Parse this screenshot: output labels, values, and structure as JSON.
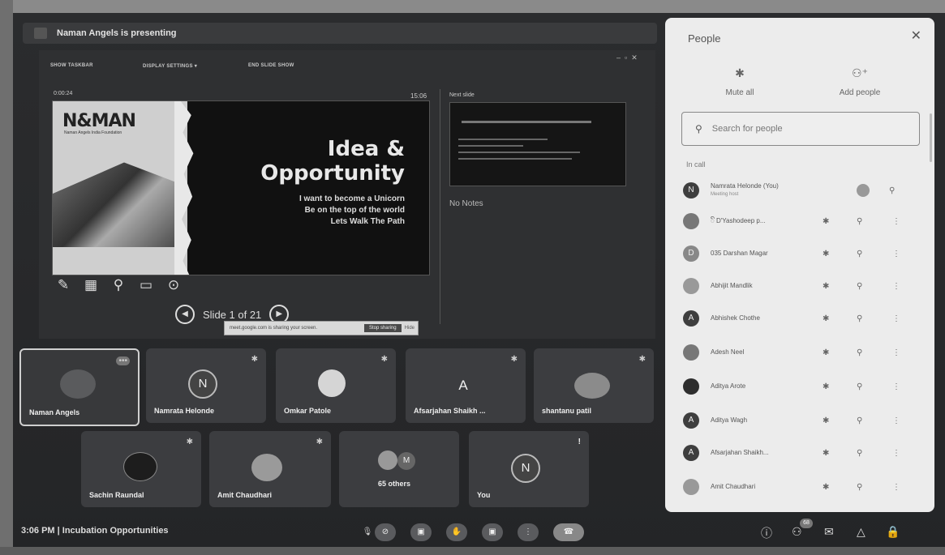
{
  "banner": {
    "presenting": "Naman Angels is presenting"
  },
  "presenter_toolbar": {
    "show_taskbar": "SHOW TASKBAR",
    "display_settings": "DISPLAY SETTINGS ▾",
    "end_slide_show": "END SLIDE SHOW"
  },
  "presenter_view": {
    "timer": "0:00:24",
    "clock": "15:06",
    "next_slide_label": "Next slide",
    "notes": "No Notes",
    "slide_counter": "Slide 1 of 21"
  },
  "slide": {
    "brand": "N&MAN",
    "brand_sub": "Naman Angels India Foundation",
    "title_line1": "Idea &",
    "title_line2": "Opportunity",
    "line1": "I want to become a Unicorn",
    "line2": "Be on the top of the world",
    "line3": "Lets Walk The Path"
  },
  "share_bar": {
    "text": "meet.google.com is sharing your screen.",
    "stop": "Stop sharing",
    "hide": "Hide"
  },
  "tiles": [
    {
      "name": "Naman Angels"
    },
    {
      "name": "Namrata Helonde",
      "initial": "N"
    },
    {
      "name": "Omkar Patole"
    },
    {
      "name": "Afsarjahan Shaikh ...",
      "initial": "A"
    },
    {
      "name": "shantanu patil"
    },
    {
      "name": "Sachin Raundal"
    },
    {
      "name": "Amit Chaudhari"
    },
    {
      "name": "65 others",
      "initial": "M"
    },
    {
      "name": "You",
      "initial": "N"
    }
  ],
  "people_panel": {
    "title": "People",
    "mute_all": "Mute all",
    "add_people": "Add people",
    "search_placeholder": "Search for people",
    "in_call": "In call",
    "people": [
      {
        "name": "Namrata Helonde (You)",
        "sub": "Meeting host",
        "initial": "N"
      },
      {
        "name": "ꦼ D'Yashodeep p...",
        "initial": ""
      },
      {
        "name": "035 Darshan Magar",
        "initial": "D"
      },
      {
        "name": "Abhijit Mandlik",
        "initial": ""
      },
      {
        "name": "Abhishek Chothe",
        "initial": "A"
      },
      {
        "name": "Adesh Neel",
        "initial": ""
      },
      {
        "name": "Aditya Arote",
        "initial": ""
      },
      {
        "name": "Aditya Wagh",
        "initial": "A"
      },
      {
        "name": "Afsarjahan Shaikh...",
        "initial": "A"
      },
      {
        "name": "Amit Chaudhari",
        "initial": ""
      }
    ]
  },
  "bottom_bar": {
    "time": "3:06 PM",
    "separator": "|",
    "meeting_title": "Incubation Opportunities",
    "participant_count": "68"
  },
  "colors": {
    "panel_bg": "#ececec",
    "stage_bg": "#2b2c2e",
    "tile_bg": "#3c3d40"
  }
}
